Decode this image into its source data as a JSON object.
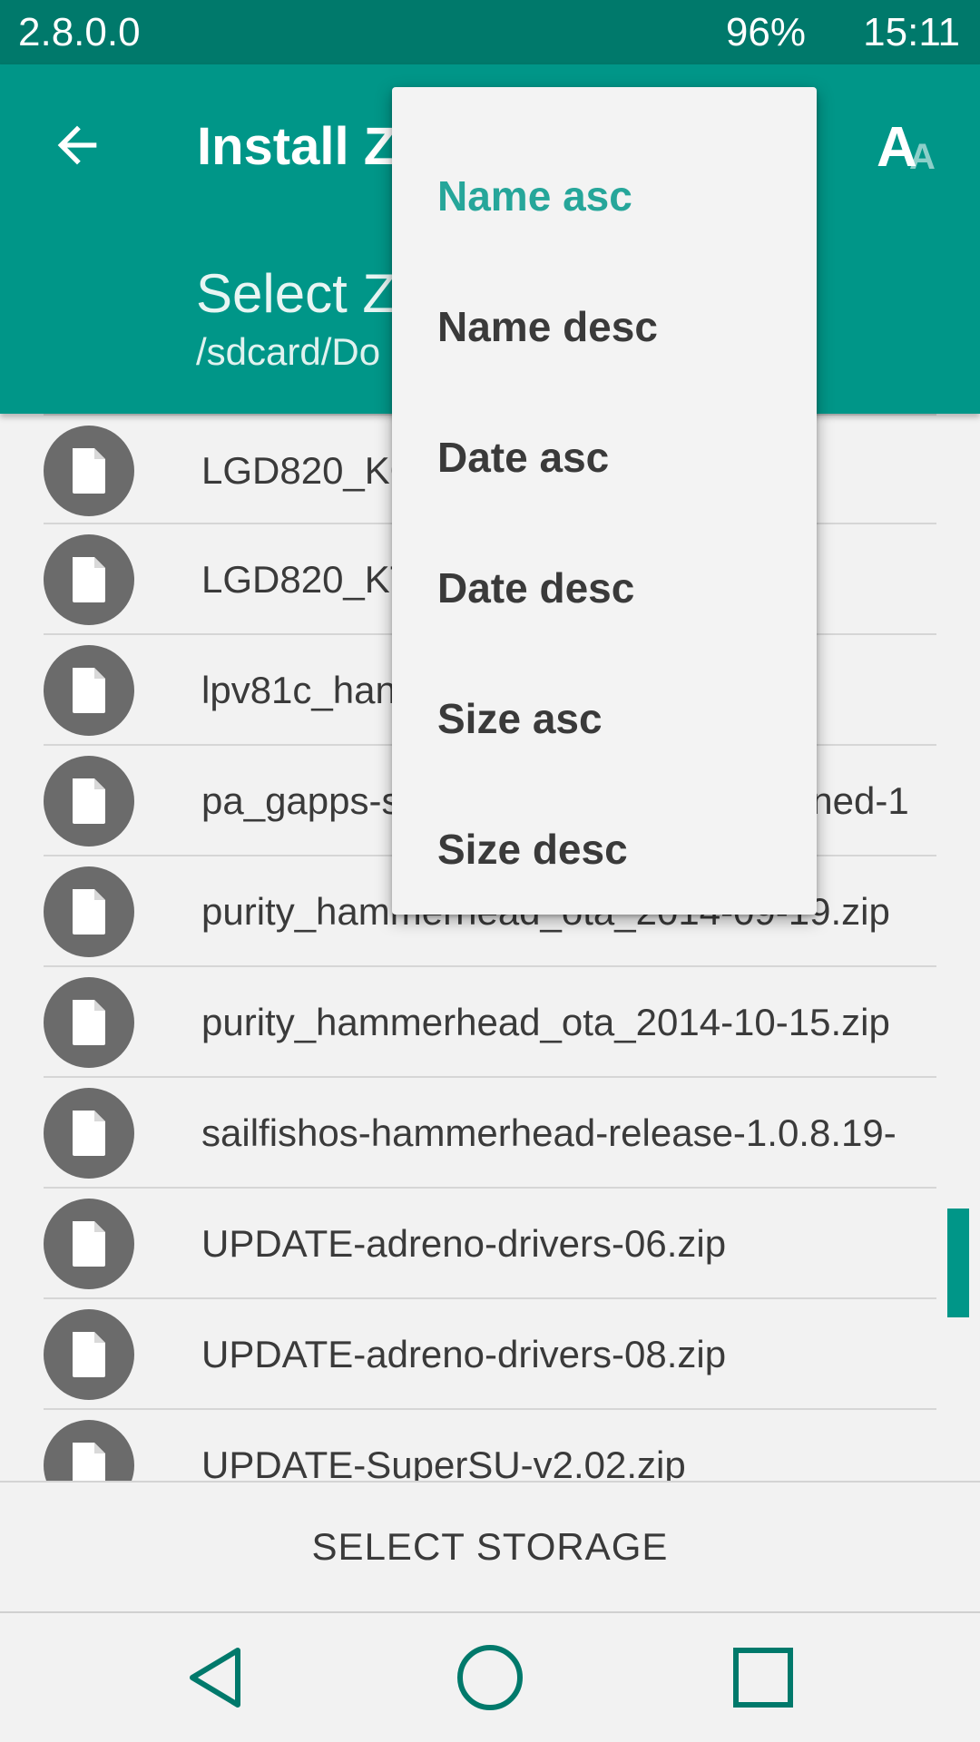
{
  "status_bar": {
    "version": "2.8.0.0",
    "battery": "96%",
    "time": "15:11"
  },
  "app_bar": {
    "back_icon": "arrow-left-icon",
    "title": "Install Z",
    "font_icon": "text-size-icon",
    "font_icon_big": "A",
    "font_icon_small": "A",
    "subtitle": "Select Z",
    "path": "/sdcard/Do"
  },
  "files": [
    {
      "name": "LGD820_KO",
      "icon": "file-icon"
    },
    {
      "name": "LGD820_KT",
      "icon": "file-icon"
    },
    {
      "name": "lpv81c_han",
      "icon": "file-icon"
    },
    {
      "name": "pa_gapps-s                                    igned-1",
      "icon": "file-icon"
    },
    {
      "name": "purity_hammerhead_ota_2014-09-19.zip",
      "icon": "file-icon"
    },
    {
      "name": "purity_hammerhead_ota_2014-10-15.zip",
      "icon": "file-icon"
    },
    {
      "name": "sailfishos-hammerhead-release-1.0.8.19-",
      "icon": "file-icon"
    },
    {
      "name": "UPDATE-adreno-drivers-06.zip",
      "icon": "file-icon"
    },
    {
      "name": "UPDATE-adreno-drivers-08.zip",
      "icon": "file-icon"
    },
    {
      "name": "UPDATE-SuperSU-v2.02.zip",
      "icon": "file-icon"
    }
  ],
  "bottom_action": {
    "label": "SELECT STORAGE"
  },
  "sort_menu": {
    "items": [
      {
        "label": "Name asc",
        "selected": true
      },
      {
        "label": "Name desc",
        "selected": false
      },
      {
        "label": "Date asc",
        "selected": false
      },
      {
        "label": "Date desc",
        "selected": false
      },
      {
        "label": "Size asc",
        "selected": false
      },
      {
        "label": "Size desc",
        "selected": false
      }
    ]
  },
  "nav_bar": {
    "back": "nav-back-icon",
    "home": "nav-home-icon",
    "recents": "nav-recents-icon"
  },
  "colors": {
    "primary": "#009688",
    "primary_dark": "#00796b",
    "accent": "#26a69a"
  }
}
